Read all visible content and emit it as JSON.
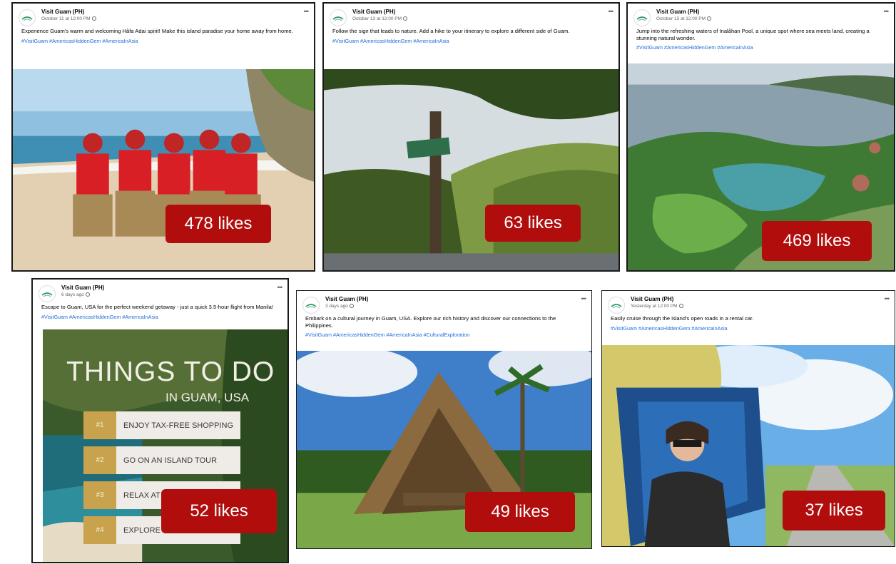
{
  "posts": [
    {
      "page_name": "Visit Guam (PH)",
      "time": "October 11 at 12:00 PM",
      "caption": "Experience Guam's warm and welcoming Håfa Adai spirit! Make this island paradise your home away from home.",
      "hashtags": "#VisitGuam #AmericasHiddenGem #AmericaInAsia",
      "likes": "478 likes",
      "image": "hula-dancers-on-beach"
    },
    {
      "page_name": "Visit Guam (PH)",
      "time": "October 13 at 12:00 PM",
      "caption": "Follow the sign that leads to nature. Add a hike to your itinerary to explore a different side of Guam.",
      "hashtags": "#VisitGuam #AmericasHiddenGem #AmericaInAsia",
      "likes": "63 likes",
      "image": "tree-with-trail-sign-and-hills"
    },
    {
      "page_name": "Visit Guam (PH)",
      "time": "October 15 at 12:00 PM",
      "caption": "Jump into the refreshing waters of Inalåhan Pool, a unique spot where sea meets land, creating a stunning natural wonder.",
      "hashtags": "#VisitGuam #AmericasHiddenGem #AmericaInAsia",
      "likes": "469 likes",
      "image": "aerial-natural-pool-coast"
    },
    {
      "page_name": "Visit Guam (PH)",
      "time": "6 days ago",
      "caption": "Escape to Guam, USA for the perfect weekend getaway - just a quick 3.5-hour flight from Manila!",
      "hashtags": "#VisitGuam #AmericasHiddenGem #AmericaInAsia",
      "likes": "52 likes",
      "image": "things-to-do-infographic",
      "infographic": {
        "title": "THINGS TO DO",
        "subtitle": "IN GUAM, USA",
        "items": [
          {
            "num": "#1",
            "label": "ENJOY TAX-FREE SHOPPING"
          },
          {
            "num": "#2",
            "label": "GO ON AN ISLAND TOUR"
          },
          {
            "num": "#3",
            "label": "RELAX AT TH"
          },
          {
            "num": "#4",
            "label": "EXPLORE GU"
          }
        ]
      }
    },
    {
      "page_name": "Visit Guam (PH)",
      "time": "3 days ago",
      "caption": "Embark on a cultural journey in Guam, USA. Explore our rich history and discover our connections to the Philippines.",
      "hashtags": "#VisitGuam #AmericasHiddenGem #AmericaInAsia #CulturalExploration",
      "likes": "49 likes",
      "image": "thatched-a-frame-hut"
    },
    {
      "page_name": "Visit Guam (PH)",
      "time": "Yesterday at 12:00 PM",
      "caption": "Easily cruise through the island's open roads in a rental car.",
      "hashtags": "#VisitGuam #AmericasHiddenGem #AmericaInAsia",
      "likes": "37 likes",
      "image": "woman-in-jeep-window"
    }
  ],
  "colors": {
    "likes_badge": "#b10d0d",
    "hashtag": "#216fdb",
    "border": "#1a1a1a"
  },
  "icons": [
    "visit-guam-logo-icon",
    "globe-icon",
    "more-options-icon"
  ]
}
